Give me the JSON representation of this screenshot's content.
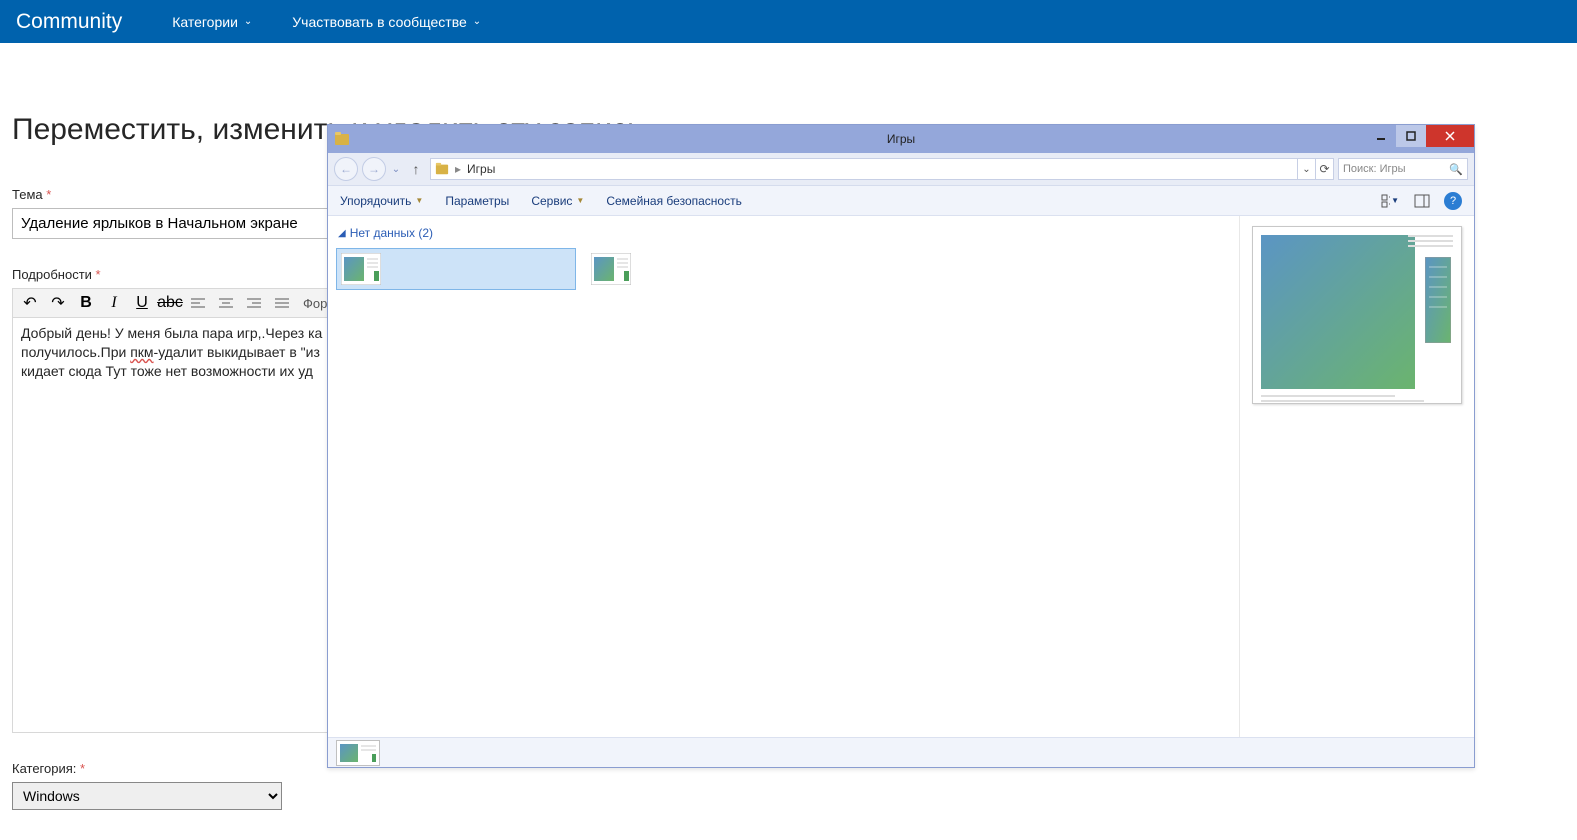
{
  "topnav": {
    "brand": "Community",
    "items": [
      "Категории",
      "Участвовать в сообществе"
    ]
  },
  "page": {
    "title": "Переместить, изменить и удалить эту запись",
    "topic_label": "Тема",
    "topic_value": "Удаление ярлыков в Начальном экране",
    "details_label": "Подробности",
    "format_label": "Фор",
    "body_part1": "Добрый день! У меня была пара игр,.Через ка",
    "body_part2a": "получилось.При ",
    "body_part2_spelled": "пкм",
    "body_part2b": "-удалит выкидывает в \"из",
    "body_part3": "кидает сюда   Тут тоже нет возможности их уд",
    "category_label": "Категория:",
    "category_value": "Windows"
  },
  "explorer": {
    "title": "Игры",
    "breadcrumb": "Игры",
    "search_placeholder": "Поиск: Игры",
    "menu": {
      "organize": "Упорядочить",
      "params": "Параметры",
      "service": "Сервис",
      "family": "Семейная безопасность"
    },
    "group_header": "Нет данных (2)",
    "item_count": 2
  }
}
